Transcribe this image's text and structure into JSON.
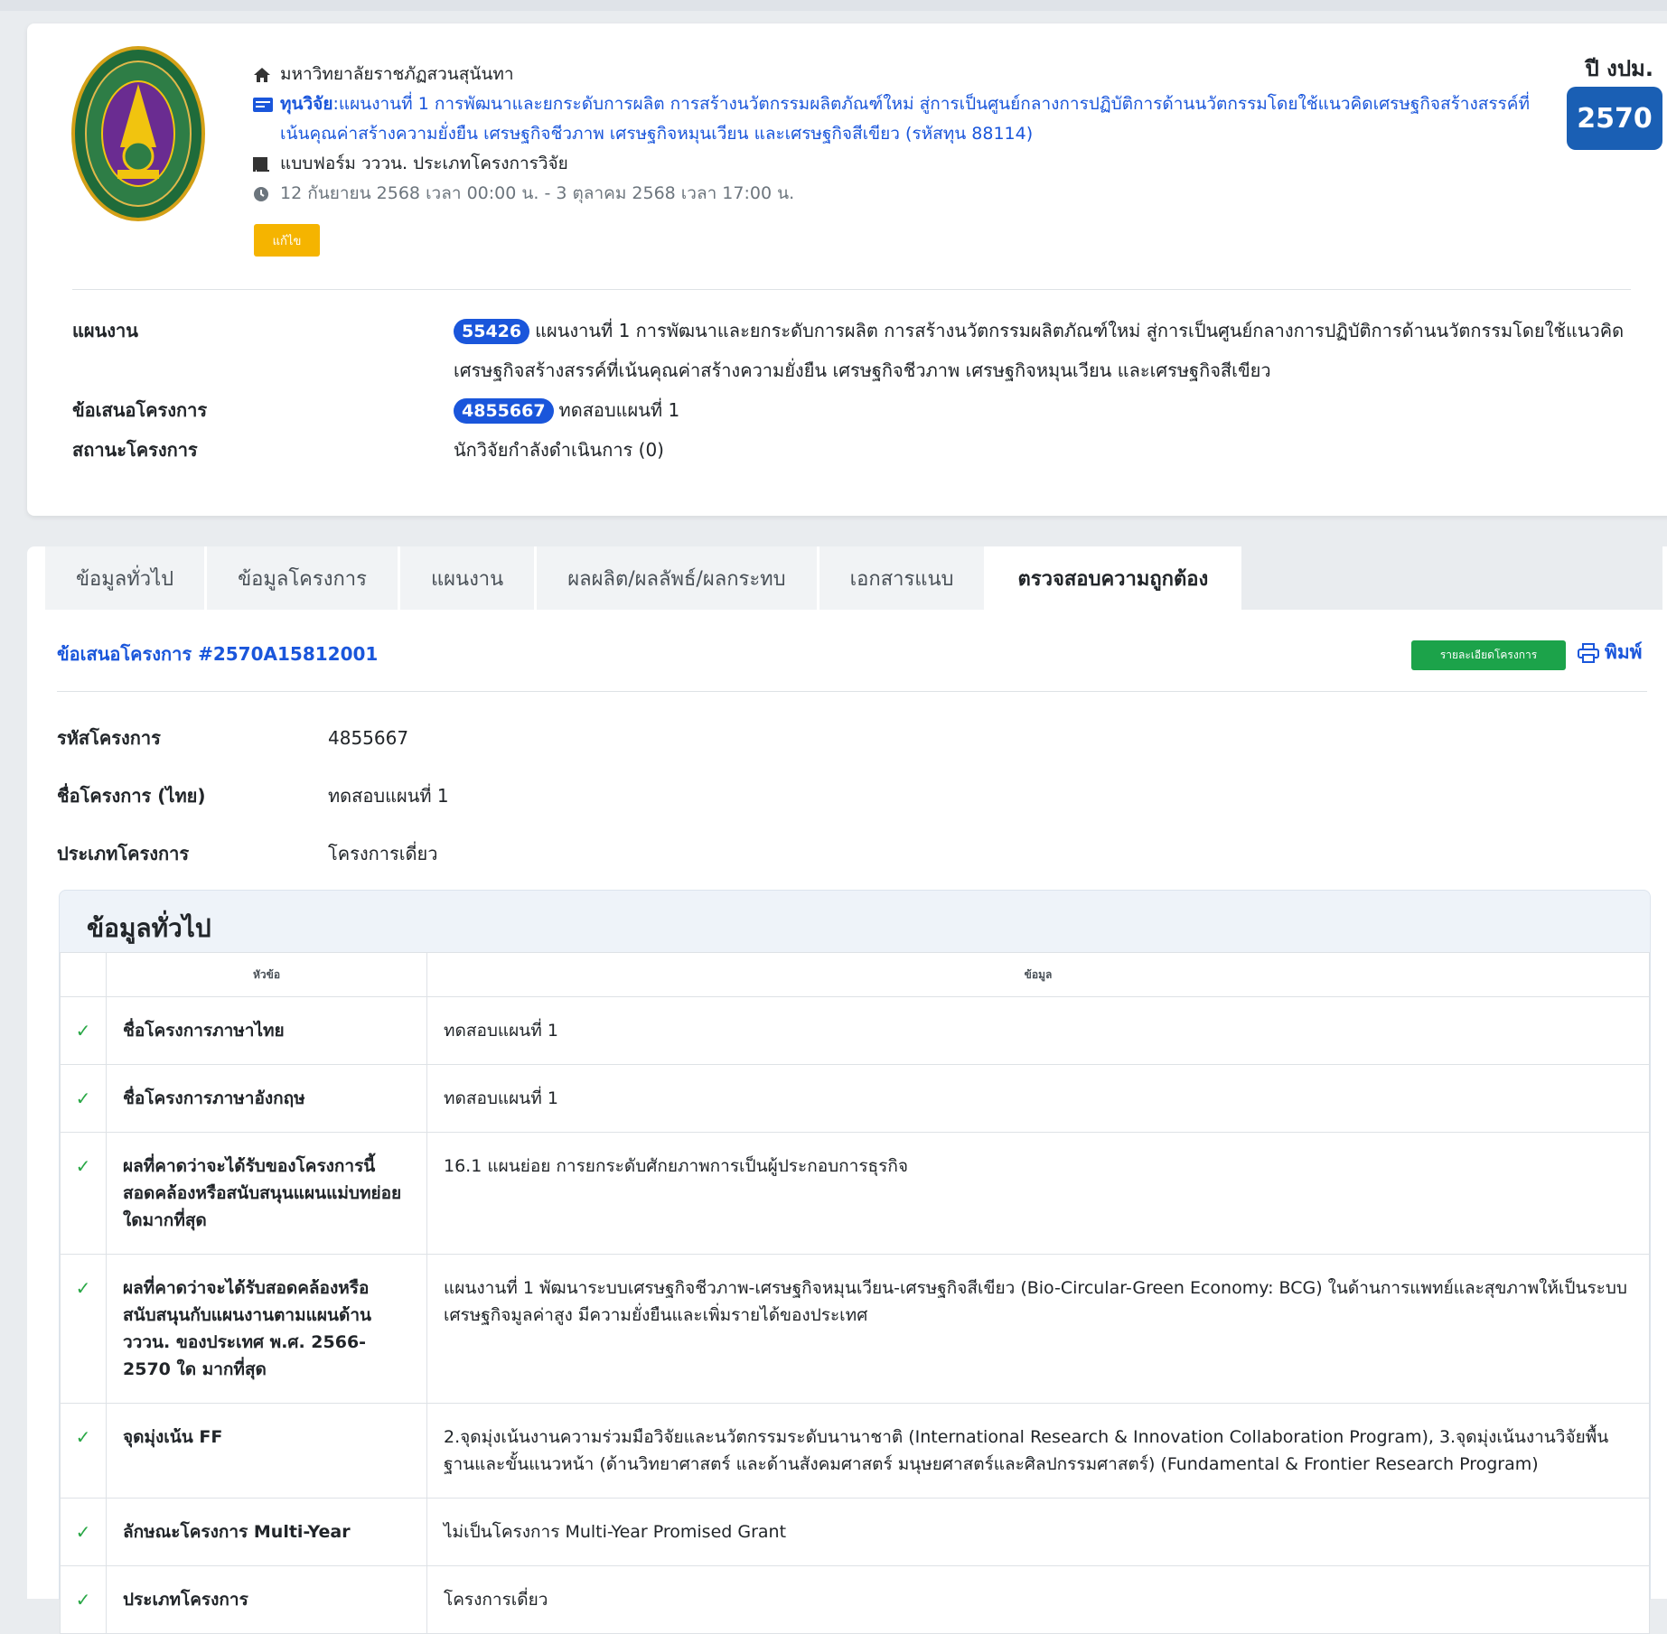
{
  "header": {
    "university": "มหาวิทยาลัยราชภัฏสวนสุนันทา",
    "grant_label": "ทุนวิจัย",
    "grant_text": ":แผนงานที่ 1 การพัฒนาและยกระดับการผลิต การสร้างนวัตกรรมผลิตภัณฑ์ใหม่ สู่การเป็นศูนย์กลางการปฏิบัติการด้านนวัตกรรมโดยใช้แนวคิดเศรษฐกิจสร้างสรรค์ที่เน้นคุณค่าสร้างความยั่งยืน เศรษฐกิจชีวภาพ เศรษฐกิจหมุนเวียน และเศรษฐกิจสีเขียว (รหัสทุน 88114)",
    "form_type": "แบบฟอร์ม วววน. ประเภทโครงการวิจัย",
    "period": "12 กันยายน 2568 เวลา 00:00 น. - 3 ตุลาคม 2568 เวลา 17:00 น.",
    "edit_label": "แก้ไข",
    "year_label": "ปี งปม.",
    "year_value": "2570"
  },
  "summary": {
    "plan_key": "แผนงาน",
    "plan_code": "55426",
    "plan_text": "แผนงานที่ 1 การพัฒนาและยกระดับการผลิต การสร้างนวัตกรรมผลิตภัณฑ์ใหม่ สู่การเป็นศูนย์กลางการปฏิบัติการด้านนวัตกรรมโดยใช้แนวคิดเศรษฐกิจสร้างสรรค์ที่เน้นคุณค่าสร้างความยั่งยืน เศรษฐกิจชีวภาพ เศรษฐกิจหมุนเวียน และเศรษฐกิจสีเขียว",
    "proposal_key": "ข้อเสนอโครงการ",
    "proposal_code": "4855667",
    "proposal_text": "ทดสอบแผนที่ 1",
    "status_key": "สถานะโครงการ",
    "status_text": "นักวิจัยกำลังดำเนินการ (0)"
  },
  "tabs": [
    {
      "label": "ข้อมูลทั่วไป"
    },
    {
      "label": "ข้อมูลโครงการ"
    },
    {
      "label": "แผนงาน"
    },
    {
      "label": "ผลผลิต/ผลลัพธ์/ผลกระทบ"
    },
    {
      "label": "เอกสารแนบ"
    },
    {
      "label": "ตรวจสอบความถูกต้อง"
    }
  ],
  "proposal": {
    "title": "ข้อเสนอโครงการ #2570A15812001",
    "detail_button": "รายละเอียดโครงการ",
    "print_label": "พิมพ์"
  },
  "facts": [
    {
      "k": "รหัสโครงการ",
      "v": "4855667"
    },
    {
      "k": "ชื่อโครงการ (ไทย)",
      "v": "ทดสอบแผนที่ 1"
    },
    {
      "k": "ประเภทโครงการ",
      "v": "โครงการเดี่ยว"
    }
  ],
  "section": {
    "title": "ข้อมูลทั่วไป",
    "col_topic": "หัวข้อ",
    "col_data": "ข้อมูล",
    "rows": [
      {
        "check": "✓",
        "topic": "ชื่อโครงการภาษาไทย",
        "value": "ทดสอบแผนที่ 1"
      },
      {
        "check": "✓",
        "topic": "ชื่อโครงการภาษาอังกฤษ",
        "value": "ทดสอบแผนที่ 1"
      },
      {
        "check": "✓",
        "topic": "ผลที่คาดว่าจะได้รับของโครงการนี้สอดคล้องหรือสนับสนุนแผนแม่บทย่อยใดมากที่สุด",
        "value": "16.1 แผนย่อย การยกระดับศักยภาพการเป็นผู้ประกอบการธุรกิจ"
      },
      {
        "check": "✓",
        "topic": "ผลที่คาดว่าจะได้รับสอดคล้องหรือสนับสนุนกับแผนงานตามแผนด้าน วววน. ของประเทศ พ.ศ. 2566-2570 ใด มากที่สุด",
        "value": "แผนงานที่ 1 พัฒนาระบบเศรษฐกิจชีวภาพ-เศรษฐกิจหมุนเวียน-เศรษฐกิจสีเขียว (Bio-Circular-Green Economy: BCG) ในด้านการแพทย์และสุขภาพให้เป็นระบบเศรษฐกิจมูลค่าสูง มีความยั่งยืนและเพิ่มรายได้ของประเทศ"
      },
      {
        "check": "✓",
        "topic": "จุดมุ่งเน้น FF",
        "value": "2.จุดมุ่งเน้นงานความร่วมมือวิจัยและนวัตกรรมระดับนานาชาติ (International Research & Innovation Collaboration Program), 3.จุดมุ่งเน้นงานวิจัยพื้นฐานและขั้นแนวหน้า (ด้านวิทยาศาสตร์ และด้านสังคมศาสตร์ มนุษยศาสตร์และศิลปกรรมศาสตร์) (Fundamental & Frontier Research Program)"
      },
      {
        "check": "✓",
        "topic": "ลักษณะโครงการ Multi-Year",
        "value": "ไม่เป็นโครงการ Multi-Year Promised Grant"
      },
      {
        "check": "✓",
        "topic": "ประเภทโครงการ",
        "value": "โครงการเดี่ยว"
      }
    ]
  }
}
